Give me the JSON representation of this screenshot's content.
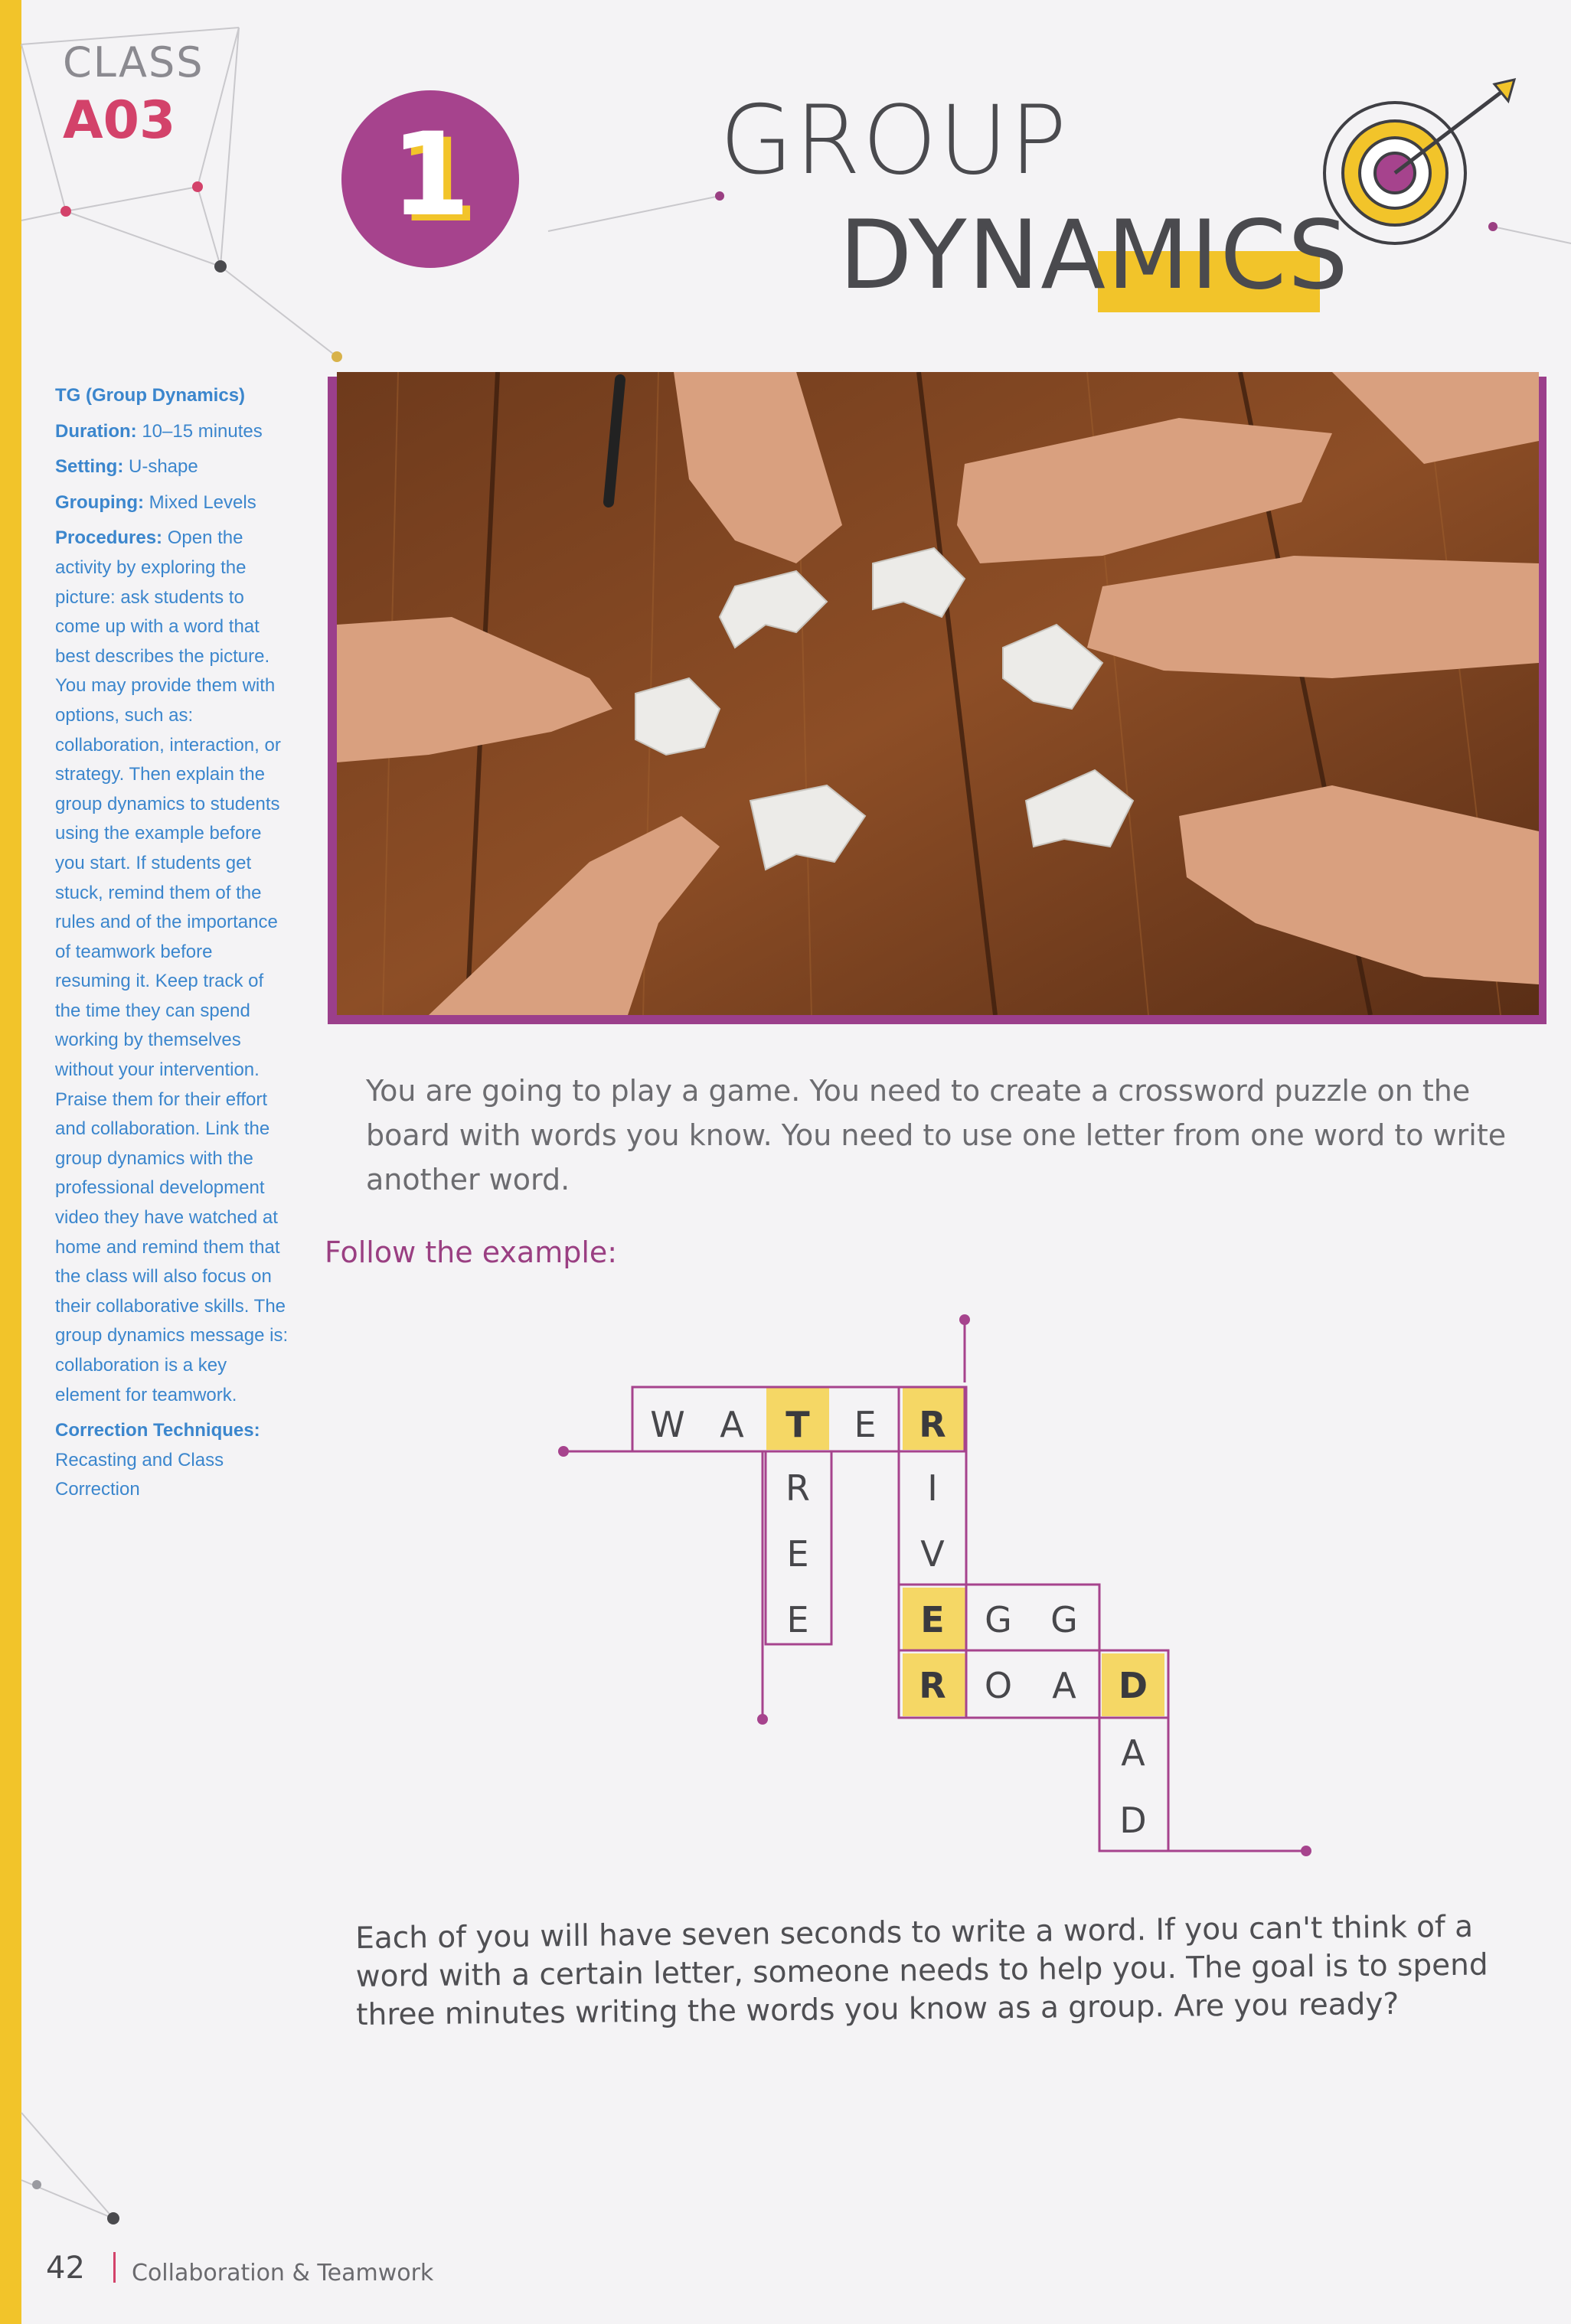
{
  "header": {
    "class_label": "CLASS",
    "class_code": "A03",
    "activity_number": "1",
    "title_line1": "GROUP",
    "title_line2": "DYNAMICS"
  },
  "sidebar": {
    "tg_label": "TG (Group Dynamics)",
    "duration_label": "Duration:",
    "duration_value": "10–15 minutes",
    "setting_label": "Setting:",
    "setting_value": "U-shape",
    "grouping_label": "Grouping:",
    "grouping_value": "Mixed Levels",
    "procedures_label": "Procedures:",
    "procedures_text": "Open the activity by exploring the picture: ask students to come up with a word that best describes the picture. You may provide them with options, such as: collaboration, interaction, or strategy. Then explain the group dynamics to students using the example before you start. If students get stuck, remind them of the rules and of the importance of teamwork before resuming it. Keep track of the time they can spend working by themselves without your intervention. Praise them for their effort and collaboration. Link the group dynamics with the professional development video they have watched at home and remind them that the class will also focus on their collaborative skills. The group dynamics message is: collaboration is a key element for teamwork.",
    "correction_label": "Correction Techniques:",
    "correction_value": "Recasting and Class Correction"
  },
  "content": {
    "intro": "You are going to play a game. You need to create a crossword puzzle on the board with words you know. You need to use one letter from one word to write another word.",
    "follow_label": "Follow the example:",
    "outro": "Each of you will have seven seconds to write a word. If you can't think of a word with a certain letter, someone needs to help you. The goal is to spend three minutes writing the words you know as a group. Are you ready?"
  },
  "crossword": {
    "words": [
      "WATER",
      "TREE",
      "RIVER",
      "EGG",
      "ROAD",
      "DAD"
    ],
    "cells": [
      {
        "letter": "W",
        "highlight": false
      },
      {
        "letter": "A",
        "highlight": false
      },
      {
        "letter": "T",
        "highlight": true
      },
      {
        "letter": "E",
        "highlight": false
      },
      {
        "letter": "R",
        "highlight": true
      },
      {
        "letter": "R",
        "highlight": false
      },
      {
        "letter": "I",
        "highlight": false
      },
      {
        "letter": "E",
        "highlight": false
      },
      {
        "letter": "V",
        "highlight": false
      },
      {
        "letter": "E",
        "highlight": false
      },
      {
        "letter": "E",
        "highlight": true
      },
      {
        "letter": "G",
        "highlight": false
      },
      {
        "letter": "G",
        "highlight": false
      },
      {
        "letter": "R",
        "highlight": true
      },
      {
        "letter": "O",
        "highlight": false
      },
      {
        "letter": "A",
        "highlight": false
      },
      {
        "letter": "D",
        "highlight": true
      },
      {
        "letter": "A",
        "highlight": false
      },
      {
        "letter": "D",
        "highlight": false
      }
    ]
  },
  "footer": {
    "page_number": "42",
    "section": "Collaboration & Teamwork"
  },
  "colors": {
    "purple": "#a6438d",
    "yellow": "#f2c42a",
    "pink": "#d3426a",
    "teacher_blue": "#3b86cd"
  },
  "icons": {
    "target": "target-with-arrow-icon"
  }
}
